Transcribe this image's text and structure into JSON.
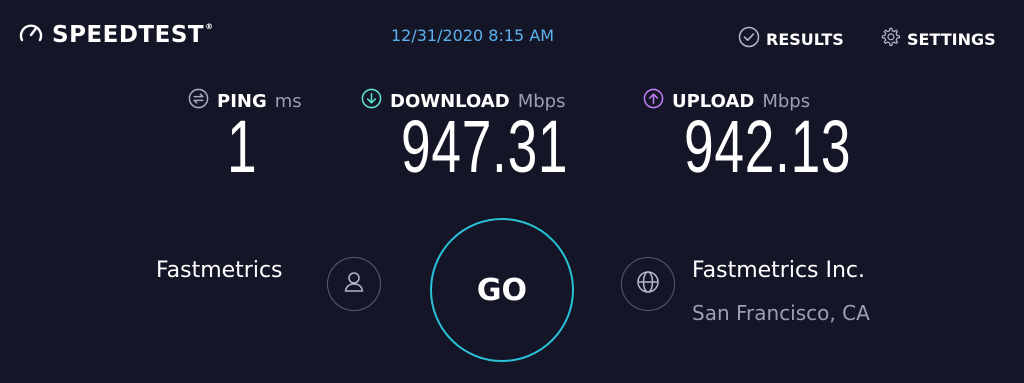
{
  "header": {
    "logo_text": "SPEEDTEST",
    "logo_tm": "®",
    "datetime": "12/31/2020 8:15 AM",
    "results_label": "RESULTS",
    "settings_label": "SETTINGS"
  },
  "metrics": {
    "ping": {
      "label": "PING",
      "unit": "ms",
      "value": "1",
      "icon": "ping-icon",
      "color": "#a5a8bd"
    },
    "download": {
      "label": "DOWNLOAD",
      "unit": "Mbps",
      "value": "947.31",
      "icon": "download-arrow-icon",
      "color": "#5fe3c9"
    },
    "upload": {
      "label": "UPLOAD",
      "unit": "Mbps",
      "value": "942.13",
      "icon": "upload-arrow-icon",
      "color": "#c07cf5"
    }
  },
  "client": {
    "isp": "Fastmetrics",
    "icon": "user-icon"
  },
  "go_label": "GO",
  "server": {
    "name": "Fastmetrics Inc.",
    "location": "San Francisco, CA",
    "icon": "globe-icon"
  },
  "colors": {
    "background": "#141526",
    "accent": "#29c1d8",
    "datetime": "#5bb3ef",
    "muted": "#9c9fb3"
  }
}
